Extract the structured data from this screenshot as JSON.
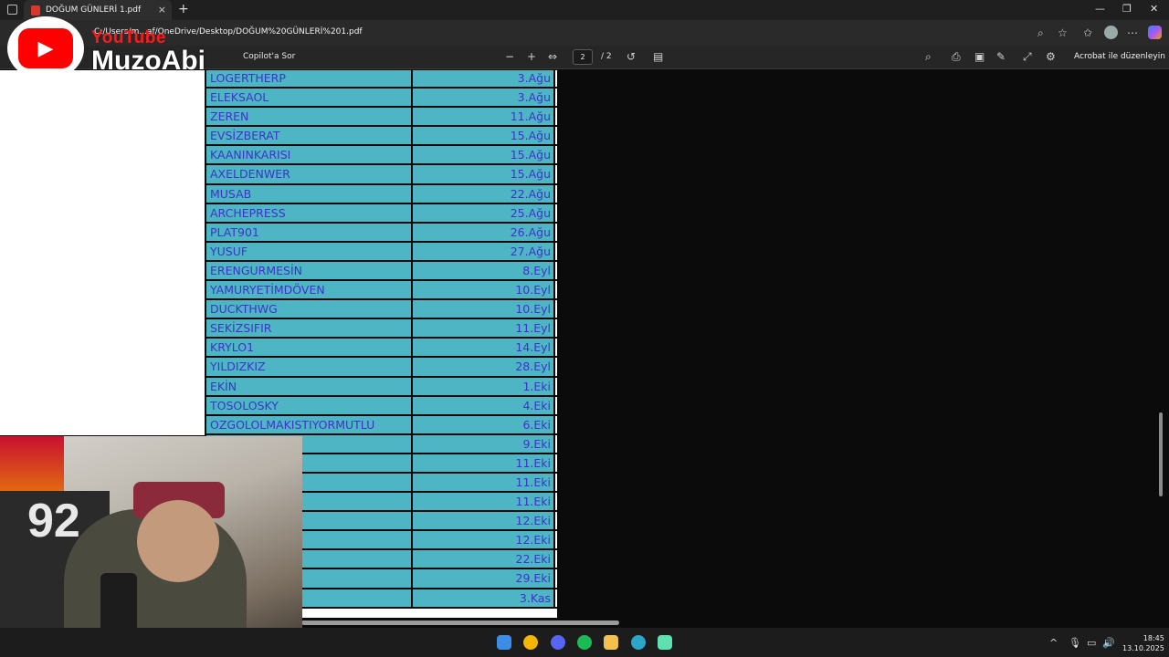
{
  "browser": {
    "tab_title": "DOĞUM GÜNLERİ 1.pdf",
    "close_glyph": "×",
    "newtab_glyph": "+",
    "url": "C:/Users/m...af/OneDrive/Desktop/DOĞUM%20GÜNLERİ%201.pdf",
    "win_minimize": "—",
    "win_restore": "❐",
    "win_close": "✕"
  },
  "pdf_toolbar": {
    "copilot_label": "Copilot'a Sor",
    "page_current": "2",
    "page_total": "/ 2",
    "edit_label": "Acrobat ile düzenleyin"
  },
  "overlay": {
    "youtube_word": "YouTube",
    "channel_name": "MuzoAbi",
    "jersey_number": "92"
  },
  "birthdays": [
    {
      "name": "LOGERTHERP",
      "date": "3.Ağu"
    },
    {
      "name": "ELEKSAOL",
      "date": "3.Ağu"
    },
    {
      "name": "ZEREN",
      "date": "11.Ağu"
    },
    {
      "name": "EVSİZBERAT",
      "date": "15.Ağu"
    },
    {
      "name": "KAANINKARISI",
      "date": "15.Ağu"
    },
    {
      "name": "AXELDENWER",
      "date": "15.Ağu"
    },
    {
      "name": "MUSAB",
      "date": "22.Ağu"
    },
    {
      "name": "ARCHEPRESS",
      "date": "25.Ağu"
    },
    {
      "name": "PLAT901",
      "date": "26.Ağu"
    },
    {
      "name": "YUSUF",
      "date": "27.Ağu"
    },
    {
      "name": "ERENGURMESİN",
      "date": "8.Eyl"
    },
    {
      "name": "YAMURYETİMDÖVEN",
      "date": "10.Eyl"
    },
    {
      "name": "DUCKTHWG",
      "date": "10.Eyl"
    },
    {
      "name": "SEKİZSIFIR",
      "date": "11.Eyl"
    },
    {
      "name": "KRYLO1",
      "date": "14.Eyl"
    },
    {
      "name": "YILDIZKIZ",
      "date": "28.Eyl"
    },
    {
      "name": "EKİN",
      "date": "1.Eki"
    },
    {
      "name": "TOSOLOSKY",
      "date": "4.Eki"
    },
    {
      "name": "OZGOLOLMAKISTIYORMUTLU",
      "date": "6.Eki"
    },
    {
      "name": "",
      "date": "9.Eki"
    },
    {
      "name": "",
      "date": "11.Eki"
    },
    {
      "name": "",
      "date": "11.Eki"
    },
    {
      "name": "",
      "date": "11.Eki"
    },
    {
      "name": "",
      "date": "12.Eki"
    },
    {
      "name": "",
      "date": "12.Eki"
    },
    {
      "name": "",
      "date": "22.Eki"
    },
    {
      "name": "",
      "date": "29.Eki"
    },
    {
      "name": "",
      "date": "3.Kas"
    }
  ],
  "taskbar": {
    "time": "18:45",
    "date": "13.10.2025"
  },
  "colors": {
    "cell_bg": "#4eb5c4",
    "cell_text": "#3e34c8"
  }
}
